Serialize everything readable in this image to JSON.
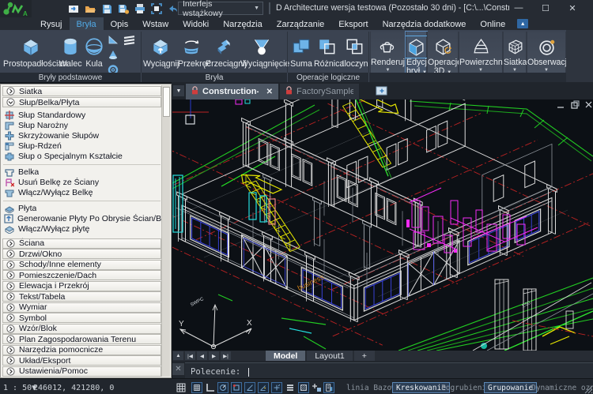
{
  "colors": {
    "accent_blue": "#51aae6",
    "icon_blue": "#62aede",
    "canvas_bg": "#0c1015",
    "wire_white": "#dcdcdc",
    "wire_red": "#bb2222",
    "wire_green": "#22cc22",
    "wire_yellow": "#e6e600",
    "wire_magenta": "#f52bf5",
    "wire_cyan": "#23dede",
    "wire_blue": "#3c46e8",
    "lock_red": "#d03a3a"
  },
  "title_bar": {
    "title": "D Architecture wersja testowa (Pozostało 30 dni)  - [C:\\...\\Construction-fz.dwg - Tylko do oc",
    "interface_select": "Interfejs wstążkowy",
    "window_buttons": [
      "minimize",
      "maximize",
      "close"
    ],
    "qat_icons": [
      "new-file",
      "open-folder",
      "save",
      "save-as",
      "print",
      "plot-preview",
      "undo",
      "redo",
      "help"
    ]
  },
  "ribbon_tabs": [
    {
      "label": "Rysuj",
      "active": false
    },
    {
      "label": "Bryła",
      "active": true
    },
    {
      "label": "Opis",
      "active": false
    },
    {
      "label": "Wstaw",
      "active": false
    },
    {
      "label": "Widoki",
      "active": false
    },
    {
      "label": "Narzędzia",
      "active": false
    },
    {
      "label": "Zarządzanie",
      "active": false
    },
    {
      "label": "Eksport",
      "active": false
    },
    {
      "label": "Narzędzia dodatkowe",
      "active": false
    },
    {
      "label": "Online",
      "active": false
    }
  ],
  "ribbon": {
    "groups": [
      {
        "label": "Bryły podstawowe",
        "buttons": [
          "Prostopadłościan",
          "Walec",
          "Kula"
        ],
        "small_icons": [
          "wedge-icon",
          "cone-icon",
          "torus-icon",
          "polysolid-icon"
        ]
      },
      {
        "label": "Bryła",
        "buttons": [
          "Wyciągnij",
          "Przekręć",
          "Przeciągnij",
          "Wyciągnięcie"
        ]
      },
      {
        "label": "Operacje logiczne",
        "buttons": [
          "Suma",
          "Różnica",
          "Iloczyn"
        ]
      }
    ],
    "dropdown_buttons": [
      {
        "label1": "Renderuj",
        "label2": "",
        "selected": false
      },
      {
        "label1": "Edycja",
        "label2": "brył",
        "selected": true
      },
      {
        "label1": "Operacje",
        "label2": "3D",
        "selected": false
      },
      {
        "label1": "Powierzchnie",
        "label2": "",
        "selected": false
      },
      {
        "label1": "Siatka",
        "label2": "",
        "selected": false
      },
      {
        "label1": "Obserwacja",
        "label2": "",
        "selected": false
      }
    ]
  },
  "palette": {
    "sections": [
      {
        "label": "Siatka",
        "expanded": false
      },
      {
        "label": "Słup/Belka/Płyta",
        "expanded": true
      }
    ],
    "items": [
      [
        {
          "label": "Słup Standardowy",
          "icon": "column-standard-icon"
        },
        {
          "label": "Słup Narożny",
          "icon": "column-corner-icon"
        },
        {
          "label": "Skrzyżowanie Słupów",
          "icon": "column-cross-icon"
        },
        {
          "label": "Słup-Rdzeń",
          "icon": "column-core-icon"
        },
        {
          "label": "Słup o Specjalnym Kształcie",
          "icon": "column-special-icon"
        }
      ],
      [
        {
          "label": "Belka",
          "icon": "beam-icon"
        },
        {
          "label": "Usuń Belkę ze Ściany",
          "icon": "beam-remove-icon"
        },
        {
          "label": "Włącz/Wyłącz Belkę",
          "icon": "beam-toggle-icon"
        }
      ],
      [
        {
          "label": "Płyta",
          "icon": "slab-icon"
        },
        {
          "label": "Generowanie Płyty Po Obrysie Ścian/Belek",
          "icon": "slab-generate-icon"
        },
        {
          "label": "Włącz/Wyłącz płytę",
          "icon": "slab-toggle-icon"
        }
      ]
    ],
    "collapsed_sections": [
      "Ściana",
      "Drzwi/Okno",
      "Schody/Inne elementy",
      "Pomieszczenie/Dach",
      "Elewacja i Przekrój",
      "Tekst/Tabela",
      "Wymiar",
      "Symbol",
      "Wzór/Blok",
      "Plan Zagospodarowania Terenu",
      "Narzędzia pomocnicze",
      "Układ/Eksport",
      "Ustawienia/Pomoc"
    ]
  },
  "doc_tabs": [
    {
      "label": "Construction-fz.dwg*",
      "active": true,
      "locked": true,
      "closable": true
    },
    {
      "label": "FactorySample.dwg*",
      "active": false,
      "locked": true,
      "closable": false
    }
  ],
  "canvas_labels": {
    "business": "business",
    "swpc": "SWPC",
    "scale_note": "1:50",
    "ucs_x": "X",
    "ucs_y": "Y",
    "mdi_controls": [
      "minimize",
      "restore",
      "close"
    ]
  },
  "layout_bar": {
    "nav": [
      "first",
      "prev-page",
      "prev",
      "next",
      "last"
    ],
    "tabs": [
      {
        "label": "Model",
        "active": true
      },
      {
        "label": "Layout1",
        "active": false
      }
    ],
    "add_label": "+"
  },
  "command_line": {
    "prompt": "Polecenie:"
  },
  "status_bar": {
    "scale": "1 : 50",
    "coords": "246012, 421280, 0",
    "icons": [
      "grid-icon",
      "snap-grid-icon",
      "ortho-icon",
      "polar-icon",
      "esnap-icon",
      "angle-icon",
      "otrack-icon",
      "dyn-ucs-icon",
      "lineweight-icon",
      "hatch-box-icon",
      "annotation-add-icon",
      "building-icon"
    ],
    "toggles": [
      {
        "label": "linia Bazowa",
        "active": false
      },
      {
        "label": "Kreskowanie",
        "active": true
      },
      {
        "label": "Pogrubienie",
        "active": false
      },
      {
        "label": "Grupowanie",
        "active": true
      },
      {
        "label": "Dynamiczne oznak",
        "active": false
      }
    ]
  }
}
